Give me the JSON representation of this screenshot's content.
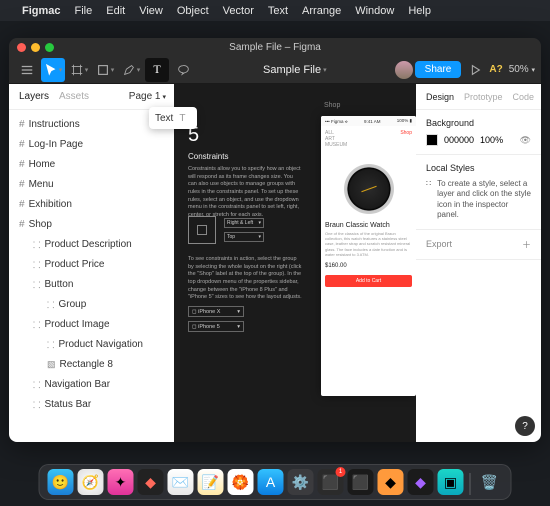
{
  "menubar": {
    "app": "Figmac",
    "items": [
      "File",
      "Edit",
      "View",
      "Object",
      "Vector",
      "Text",
      "Arrange",
      "Window",
      "Help"
    ]
  },
  "window": {
    "titlebar": "Sample File – Figma",
    "file_label": "Sample File",
    "share": "Share",
    "a_q": "A?",
    "zoom": "50%"
  },
  "left": {
    "tabs": {
      "layers": "Layers",
      "assets": "Assets"
    },
    "page": "Page 1",
    "popup": {
      "label": "Text",
      "key": "T"
    },
    "layers": [
      "Instructions",
      "Log-In Page",
      "Home",
      "Menu",
      "Exhibition",
      "Shop"
    ],
    "shop_children": [
      "Product Description",
      "Product Price",
      "Button",
      "Group",
      "Product Image",
      "Product Navigation",
      "Rectangle 8",
      "Navigation Bar",
      "Status Bar"
    ]
  },
  "canvas": {
    "big5": "5",
    "constraints": "Constraints",
    "body1": "Constraints allow you to specify how an object will respond as its frame changes size. You can also use objects to manage groups with rules in the constraints panel. To set up these rules, select an object, and use the dropdown menu in the constraints panel to set left, right, center, or stretch for each axis.",
    "sel1": "Right & Left",
    "sel2": "Top",
    "body2": "To see constraints in action, select the group by selecting the whole layout on the right (click the \"Shop\" label at the top of the group). In the top dropdown menu of the properties sidebar, change between the \"iPhone 8 Plus\" and \"iPhone 5\" sizes to see how the layout adjusts.",
    "dev1": "iPhone X",
    "dev2": "iPhone 5",
    "shop_tag": "Shop",
    "device": {
      "carrier": "••• Figma ⟡",
      "time": "9:41 AM",
      "batt": "100% ▮",
      "tabs": [
        "ALL",
        "ART",
        "MUSEUM"
      ],
      "shop": "Shop",
      "title": "Braun Classic Watch",
      "desc": "One of the classics of the original Braun collection, this watch features a stainless steel case, leather strap and scratch resistant mineral glass. The face includes a date function and is water resistant to 3 ATM.",
      "price": "$160.00",
      "cta": "Add to Cart"
    }
  },
  "right": {
    "tabs": {
      "design": "Design",
      "proto": "Prototype",
      "code": "Code"
    },
    "bg": {
      "label": "Background",
      "hex": "000000",
      "pct": "100%"
    },
    "ls": {
      "label": "Local Styles",
      "hint": "To create a style, select a layer and click on the style icon in the inspector panel."
    },
    "export": "Export"
  },
  "dock": {
    "badge": "1"
  }
}
